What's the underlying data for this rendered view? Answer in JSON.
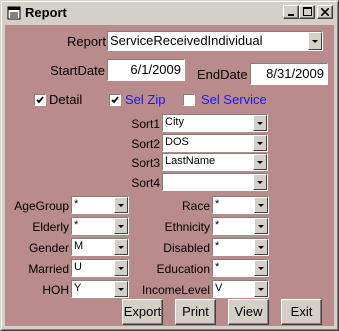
{
  "window": {
    "title": "Report",
    "controls": {
      "minimize": "_",
      "maximize": "□",
      "close": "✕"
    }
  },
  "form": {
    "report": {
      "label": "Report",
      "value": "ServiceReceivedIndividual"
    },
    "start_date": {
      "label": "StartDate",
      "value": "6/1/2009"
    },
    "end_date": {
      "label": "EndDate",
      "value": "8/31/2009"
    },
    "checks": {
      "detail": {
        "label": "Detail",
        "checked": true
      },
      "sel_zip": {
        "label": "Sel Zip",
        "checked": true
      },
      "sel_service": {
        "label": "Sel Service",
        "checked": false
      }
    },
    "sorts": [
      {
        "label": "Sort1",
        "value": "City"
      },
      {
        "label": "Sort2",
        "value": "DOS"
      },
      {
        "label": "Sort3",
        "value": "LastName"
      },
      {
        "label": "Sort4",
        "value": ""
      }
    ],
    "filters_left": [
      {
        "label": "AgeGroup",
        "value": "*"
      },
      {
        "label": "Elderly",
        "value": "*"
      },
      {
        "label": "Gender",
        "value": "M"
      },
      {
        "label": "Married",
        "value": "U"
      },
      {
        "label": "HOH",
        "value": "Y"
      }
    ],
    "filters_right": [
      {
        "label": "Race",
        "value": "*"
      },
      {
        "label": "Ethnicity",
        "value": "*"
      },
      {
        "label": "Disabled",
        "value": "*"
      },
      {
        "label": "Education",
        "value": "*"
      },
      {
        "label": "IncomeLevel",
        "value": "V"
      }
    ],
    "buttons": {
      "export": "Export",
      "print": "Print",
      "view": "View",
      "exit": "Exit"
    }
  },
  "colors": {
    "form_background": "#b98b8b",
    "accent_label": "#1a1aff"
  }
}
